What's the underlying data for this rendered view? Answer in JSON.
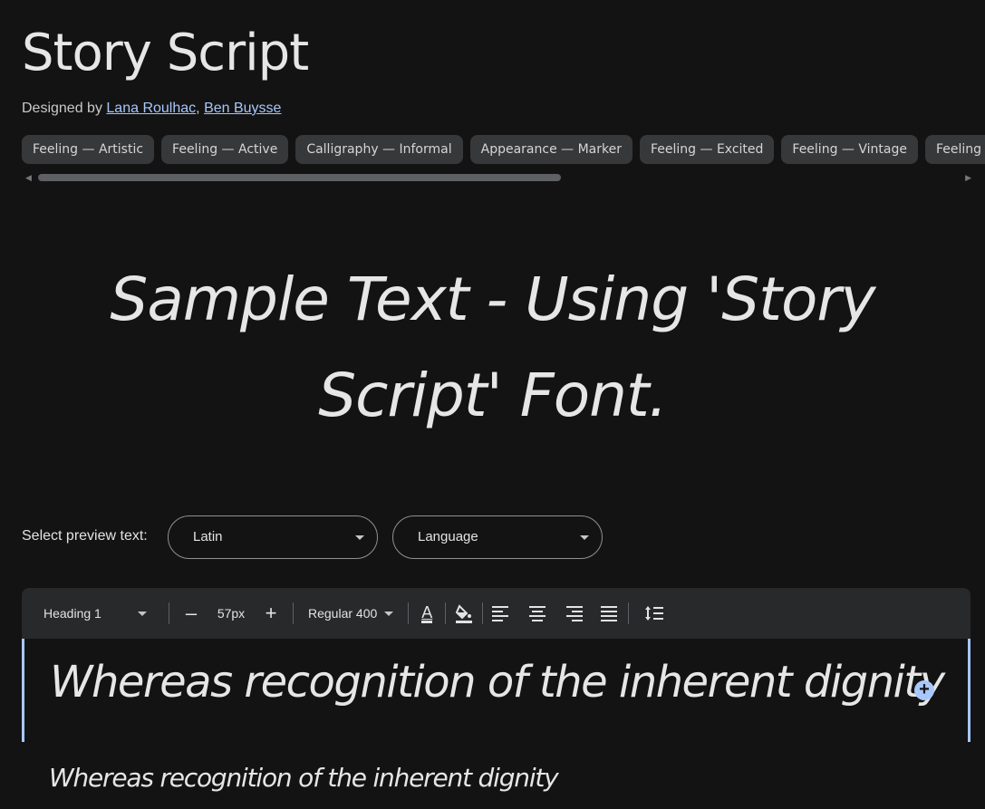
{
  "font": {
    "title": "Story Script",
    "designed_by_label": "Designed by",
    "designers": [
      "Lana Roulhac",
      "Ben Buysse"
    ],
    "separator": ","
  },
  "tags": [
    "Feeling — Artistic",
    "Feeling — Active",
    "Calligraphy — Informal",
    "Appearance — Marker",
    "Feeling — Excited",
    "Feeling — Vintage",
    "Feeling —"
  ],
  "sample_text": "Sample Text - Using 'Story Script' Font.",
  "preview": {
    "label": "Select preview text:",
    "script_select": "Latin",
    "language_select": "Language"
  },
  "toolbar": {
    "style_select": "Heading 1",
    "decrease_label": "–",
    "size": "57px",
    "increase_label": "+",
    "weight_select": "Regular 400",
    "text_color_icon": "A",
    "accent_color": "#a8c7fa"
  },
  "editor": {
    "text": "Whereas recognition of the inherent dignity",
    "add_label": "+"
  },
  "preview_line": "Whereas recognition of the inherent dignity"
}
